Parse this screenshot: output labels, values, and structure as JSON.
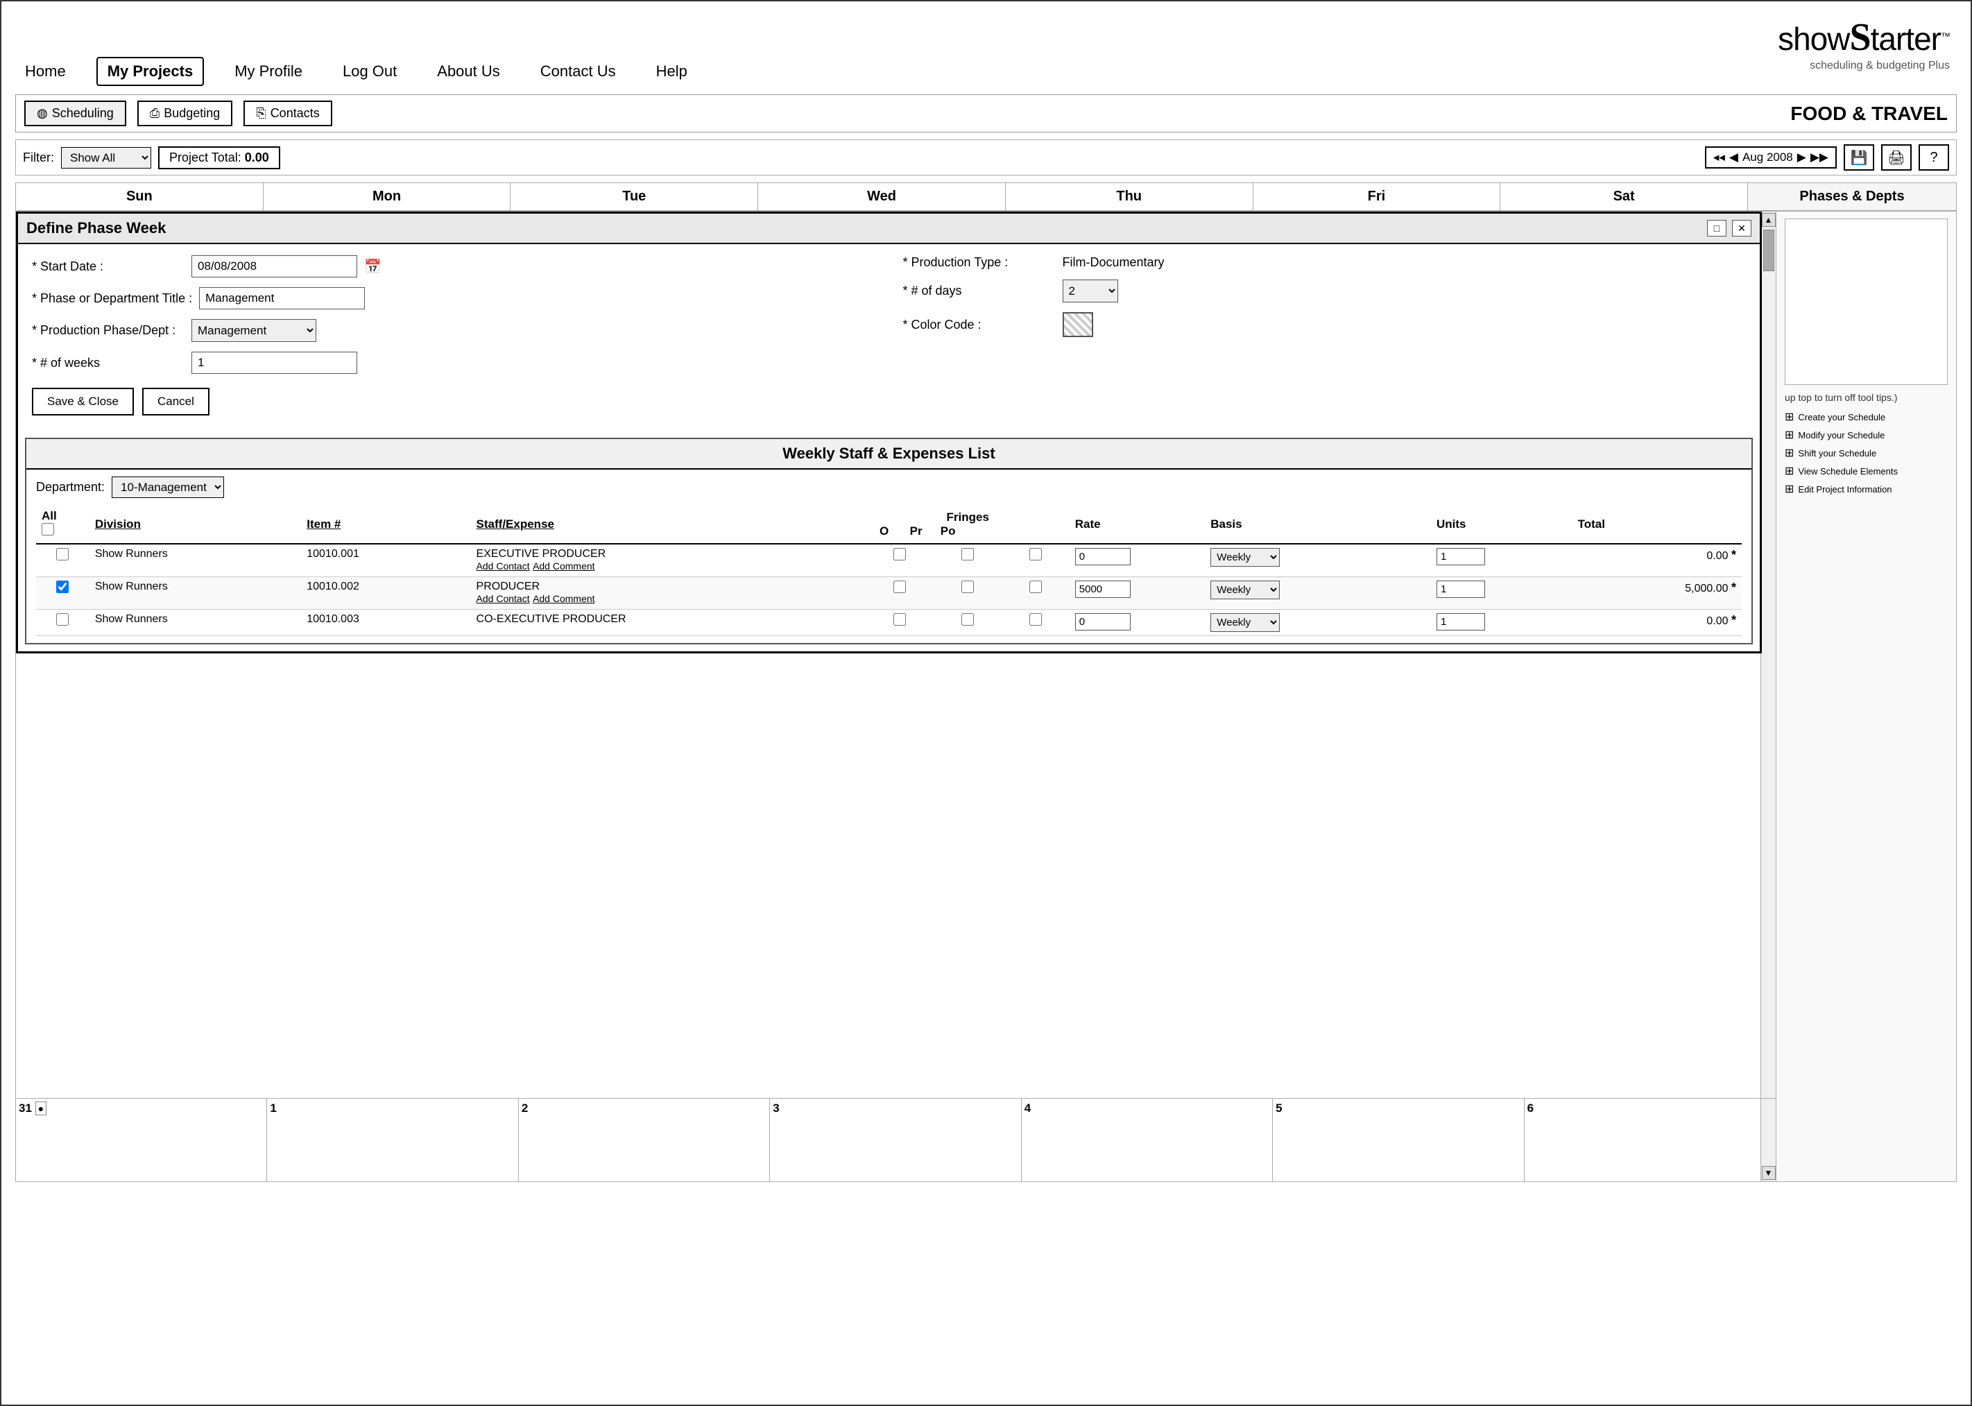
{
  "app": {
    "title": "ShowStarter",
    "subtitle": "scheduling & budgeting Plus",
    "trademark": "™"
  },
  "nav": {
    "items": [
      {
        "id": "home",
        "label": "Home",
        "active": false
      },
      {
        "id": "my-projects",
        "label": "My Projects",
        "active": true
      },
      {
        "id": "my-profile",
        "label": "My Profile",
        "active": false
      },
      {
        "id": "log-out",
        "label": "Log Out",
        "active": false
      },
      {
        "id": "about-us",
        "label": "About Us",
        "active": false
      },
      {
        "id": "contact-us",
        "label": "Contact Us",
        "active": false
      },
      {
        "id": "help",
        "label": "Help",
        "active": false
      }
    ]
  },
  "toolbar": {
    "scheduling_label": "Scheduling",
    "budgeting_label": "Budgeting",
    "contacts_label": "Contacts",
    "brand_title": "FOOD & TRAVEL"
  },
  "filter_bar": {
    "filter_label": "Filter:",
    "filter_value": "Show All",
    "project_total_label": "Project Total:",
    "project_total_value": "0.00",
    "nav_month": "Aug 2008"
  },
  "calendar": {
    "days": [
      "Sun",
      "Mon",
      "Tue",
      "Wed",
      "Thu",
      "Fri",
      "Sat"
    ],
    "phases_label": "Phases & Depts",
    "bottom_cells": [
      "31",
      "1",
      "2",
      "3",
      "4",
      "5",
      "6"
    ]
  },
  "define_phase_modal": {
    "title": "Define Phase Week",
    "start_date_label": "* Start Date :",
    "start_date_value": "08/08/2008",
    "production_type_label": "* Production Type :",
    "production_type_value": "Film-Documentary",
    "phase_dept_title_label": "* Phase or Department Title :",
    "phase_dept_title_value": "Management",
    "num_days_label": "* # of days",
    "num_days_value": "2",
    "production_phase_label": "* Production Phase/Dept :",
    "production_phase_value": "Management",
    "color_code_label": "* Color Code :",
    "num_weeks_label": "* # of weeks",
    "num_weeks_value": "1",
    "save_close_label": "Save & Close",
    "cancel_label": "Cancel"
  },
  "weekly_panel": {
    "title": "Weekly Staff & Expenses List",
    "department_label": "Department:",
    "department_value": "10-Management",
    "table_headers": {
      "all": "All",
      "division": "Division",
      "item_num": "Item #",
      "staff_expense": "Staff/Expense",
      "fringes": "Fringes",
      "fringe_o": "O",
      "fringe_pr": "Pr",
      "fringe_po": "Po",
      "rate": "Rate",
      "basis": "Basis",
      "units": "Units",
      "total": "Total"
    },
    "rows": [
      {
        "checked": false,
        "division": "Show Runners",
        "item_num": "10010.001",
        "staff_expense": "EXECUTIVE PRODUCER",
        "add_contact": "Add Contact",
        "add_comment": "Add Comment",
        "fringe_o": false,
        "fringe_pr": false,
        "fringe_po": false,
        "rate": "0",
        "basis": "Weekly",
        "units": "1",
        "total": "0.00"
      },
      {
        "checked": true,
        "division": "Show Runners",
        "item_num": "10010.002",
        "staff_expense": "PRODUCER",
        "add_contact": "Add Contact",
        "add_comment": "Add Comment",
        "fringe_o": false,
        "fringe_pr": false,
        "fringe_po": false,
        "rate": "5000",
        "basis": "Weekly",
        "units": "1",
        "total": "5,000.00"
      },
      {
        "checked": false,
        "division": "Show Runners",
        "item_num": "10010.003",
        "staff_expense": "CO-EXECUTIVE PRODUCER",
        "add_contact": "Add Contact",
        "add_comment": "Add Comment",
        "fringe_o": false,
        "fringe_pr": false,
        "fringe_po": false,
        "rate": "0",
        "basis": "Weekly",
        "units": "1",
        "total": "0.00"
      }
    ]
  },
  "right_sidebar": {
    "hint": "up top to turn off tool tips.)",
    "links": [
      {
        "id": "create-schedule",
        "label": "Create your Schedule"
      },
      {
        "id": "modify-schedule",
        "label": "Modify your Schedule"
      },
      {
        "id": "shift-schedule",
        "label": "Shift your Schedule"
      },
      {
        "id": "view-schedule",
        "label": "View Schedule Elements"
      },
      {
        "id": "edit-project",
        "label": "Edit Project Information"
      }
    ]
  }
}
